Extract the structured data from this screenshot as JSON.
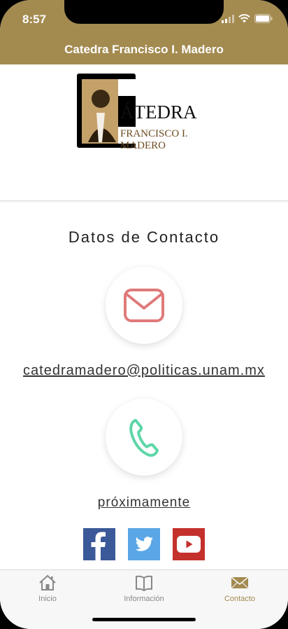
{
  "status_bar": {
    "time": "8:57",
    "icons": [
      "wifi-icon",
      "battery-icon"
    ]
  },
  "header": {
    "title": "Catedra Francisco I. Madero",
    "background": "#a38a4f"
  },
  "banner": {
    "logo": {
      "line1": "ÁTEDRA",
      "line2": "FRANCISCO I. MADERO"
    }
  },
  "contact": {
    "section_title": "Datos de Contacto",
    "email": {
      "icon": "mail-icon",
      "value": "catedramadero@politicas.unam.mx",
      "icon_color": "#e07a7a"
    },
    "phone": {
      "icon": "phone-icon",
      "value": "próximamente",
      "icon_color": "#5ed6a8"
    }
  },
  "social": [
    {
      "name": "facebook",
      "icon": "facebook-icon",
      "color": "#3b5998",
      "glyph": "f"
    },
    {
      "name": "twitter",
      "icon": "twitter-icon",
      "color": "#5aa6e6"
    },
    {
      "name": "youtube",
      "icon": "youtube-icon",
      "color": "#c4302b"
    }
  ],
  "tabbar": {
    "active_color": "#a38a4f",
    "tabs": [
      {
        "label": "Inicio",
        "icon": "home-icon",
        "active": false
      },
      {
        "label": "Información",
        "icon": "book-icon",
        "active": false
      },
      {
        "label": "Contacto",
        "icon": "envelope-icon",
        "active": true
      }
    ]
  }
}
